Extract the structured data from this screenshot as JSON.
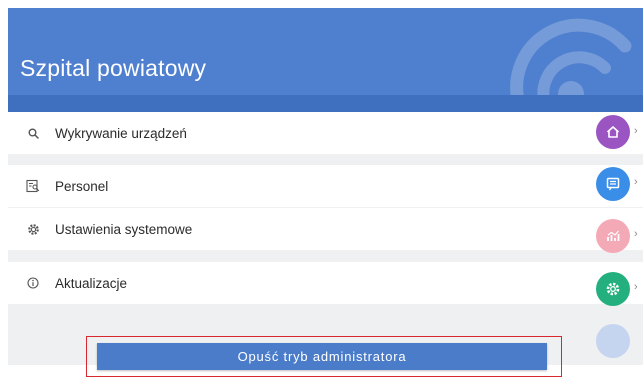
{
  "header": {
    "title": "Szpital powiatowy"
  },
  "menu": [
    {
      "label": "Wykrywanie urządzeń",
      "icon": "search-icon"
    },
    {
      "label": "Personel",
      "icon": "staff-icon"
    },
    {
      "label": "Ustawienia systemowe",
      "icon": "gear-icon"
    },
    {
      "label": "Aktualizacje",
      "icon": "info-icon"
    }
  ],
  "admin_button": {
    "label": "Opuść tryb administratora"
  },
  "fabs": [
    {
      "icon": "home-icon",
      "color": "#9b55c2"
    },
    {
      "icon": "message-icon",
      "color": "#3b8ee8"
    },
    {
      "icon": "chart-icon",
      "color": "#f4a9b6"
    },
    {
      "icon": "settings-icon",
      "color": "#23b07e"
    },
    {
      "icon": "blank-circle",
      "color": "#c5d4ef"
    }
  ],
  "colors": {
    "header": "#4f7fcf",
    "header_strip": "#3f6fbf",
    "page_bg": "#eff0f2",
    "highlight_border": "#d8272e"
  }
}
